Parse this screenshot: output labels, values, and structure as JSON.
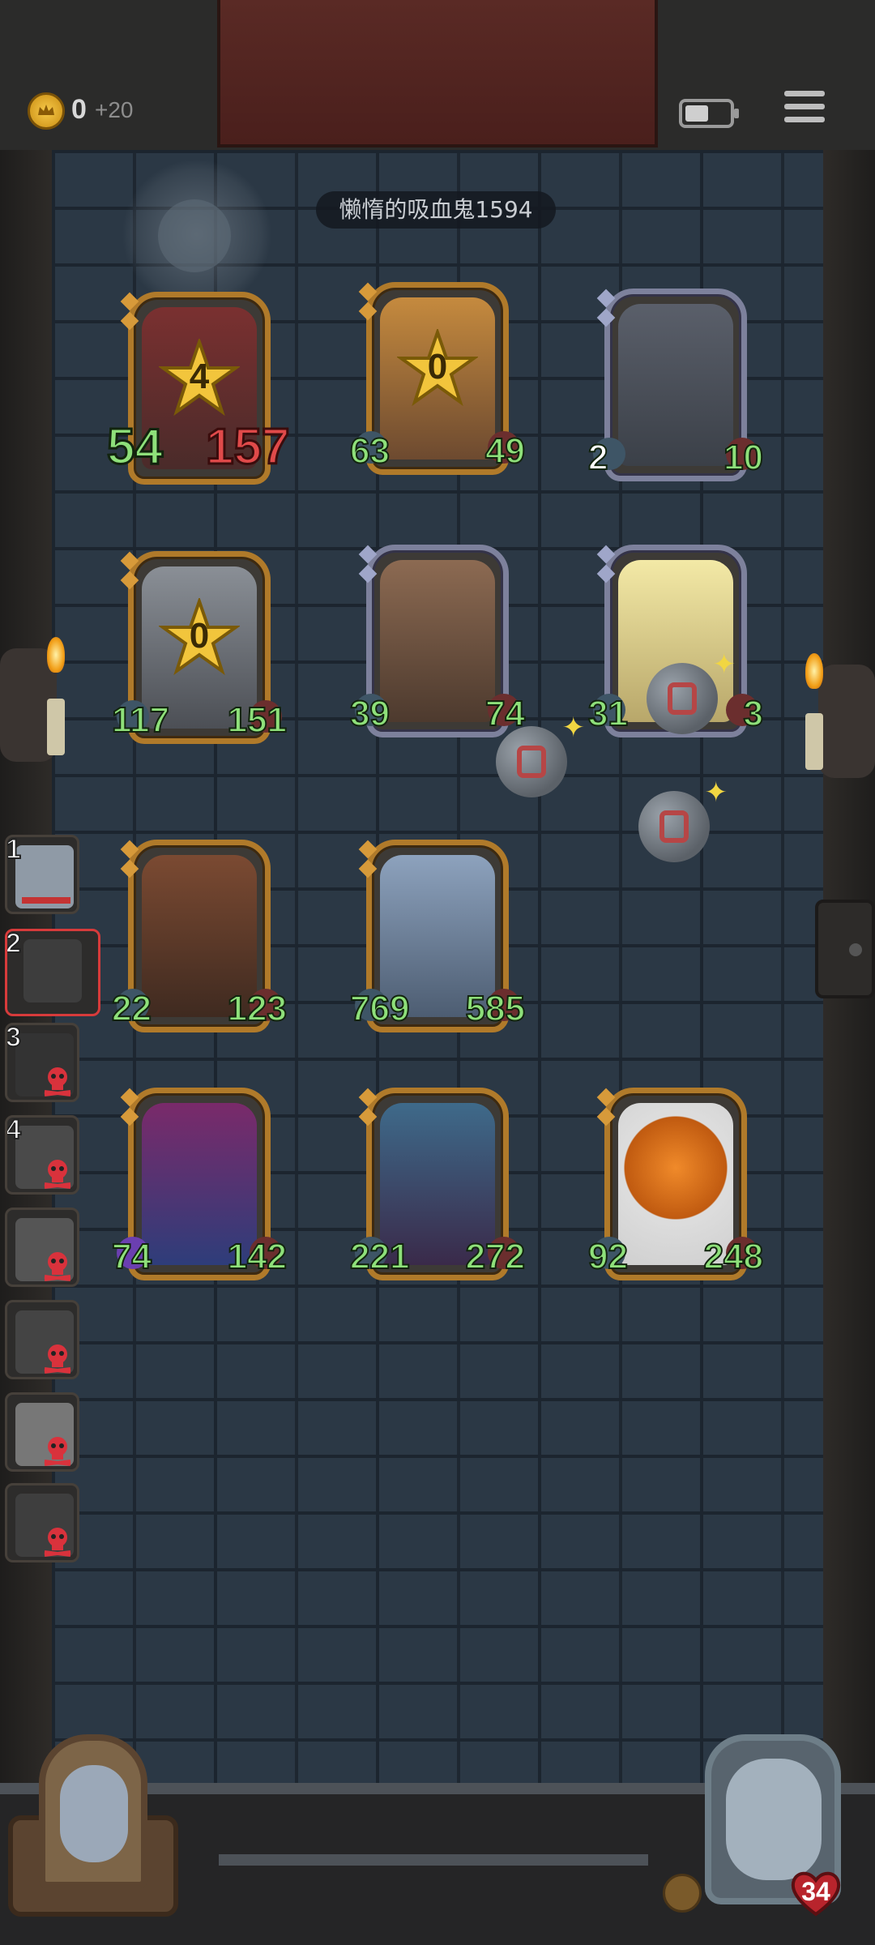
{
  "top_bar": {
    "gold": "0",
    "gold_income": "+20"
  },
  "opponent": {
    "name": "懒惰的吸血鬼1594"
  },
  "opponent_board": [
    {
      "name": "armored-knight-card",
      "atk": "54",
      "hp": "157",
      "level": "4",
      "style": "gold"
    },
    {
      "name": "blonde-warrior-card",
      "atk": "63",
      "hp": "49",
      "level": "0",
      "style": "gold"
    },
    {
      "name": "spear-boy-card",
      "atk": "2",
      "hp": "10",
      "style": "silver"
    },
    {
      "name": "steel-helmet-card",
      "atk": "117",
      "hp": "151",
      "level": "0",
      "style": "gold"
    },
    {
      "name": "big-brute-card",
      "atk": "39",
      "hp": "74",
      "style": "silver"
    },
    {
      "name": "old-dwarf-card",
      "atk": "31",
      "hp": "3",
      "style": "silver"
    }
  ],
  "player_board": [
    {
      "name": "bearded-bandit-card",
      "atk": "22",
      "hp": "123",
      "style": "gold"
    },
    {
      "name": "blue-troll-card",
      "atk": "769",
      "hp": "585",
      "style": "gold"
    },
    {
      "name": "jester-clown-card",
      "atk": "74",
      "hp": "142",
      "style": "gold"
    },
    {
      "name": "elf-sorceress-card",
      "atk": "221",
      "hp": "272",
      "style": "gold"
    },
    {
      "name": "pumpkin-head-card",
      "atk": "92",
      "hp": "248",
      "style": "gold"
    }
  ],
  "roster": [
    {
      "rank": "1",
      "eliminated": false
    },
    {
      "rank": "2",
      "eliminated": false,
      "active": true
    },
    {
      "rank": "3",
      "eliminated": true
    },
    {
      "rank": "4",
      "eliminated": true
    },
    {
      "rank": "",
      "eliminated": true
    },
    {
      "rank": "",
      "eliminated": true
    },
    {
      "rank": "",
      "eliminated": true
    },
    {
      "rank": "",
      "eliminated": true
    }
  ],
  "hero": {
    "hp": "34"
  },
  "colors": {
    "atk_green": "#8ee07a",
    "hp_red": "#e04a4a",
    "gold_frame": "#b07a2a",
    "silver_frame": "#7d819c"
  }
}
